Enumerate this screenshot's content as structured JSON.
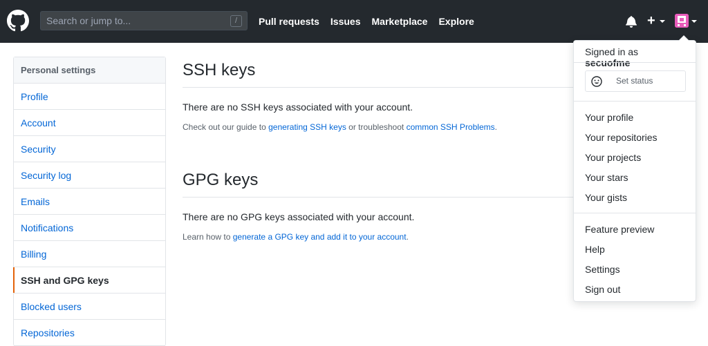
{
  "header": {
    "search_placeholder": "Search or jump to...",
    "slash_key": "/",
    "nav": [
      "Pull requests",
      "Issues",
      "Marketplace",
      "Explore"
    ],
    "plus": "+"
  },
  "sidebar": {
    "title": "Personal settings",
    "items": [
      "Profile",
      "Account",
      "Security",
      "Security log",
      "Emails",
      "Notifications",
      "Billing",
      "SSH and GPG keys",
      "Blocked users",
      "Repositories"
    ],
    "active": "SSH and GPG keys"
  },
  "main": {
    "ssh": {
      "title": "SSH keys",
      "empty": "There are no SSH keys associated with your account.",
      "note_prefix": "Check out our guide to",
      "link1": "generating SSH keys",
      "note_mid": "or troubleshoot",
      "link2": "common SSH Problems",
      "note_end": "."
    },
    "gpg": {
      "title": "GPG keys",
      "empty": "There are no GPG keys associated with your account.",
      "note_prefix": "Learn how to",
      "link": "generate a GPG key and add it to your account",
      "note_end": "."
    }
  },
  "dropdown": {
    "signed_in_prefix": "Signed in as",
    "username": "secuofme",
    "set_status": "Set status",
    "group1": [
      "Your profile",
      "Your repositories",
      "Your projects",
      "Your stars",
      "Your gists"
    ],
    "group2": [
      "Feature preview",
      "Help",
      "Settings",
      "Sign out"
    ]
  },
  "colors": {
    "header_bg": "#24292e",
    "link": "#0366d6",
    "active_marker": "#e36209",
    "avatar": "#e95cbb"
  }
}
